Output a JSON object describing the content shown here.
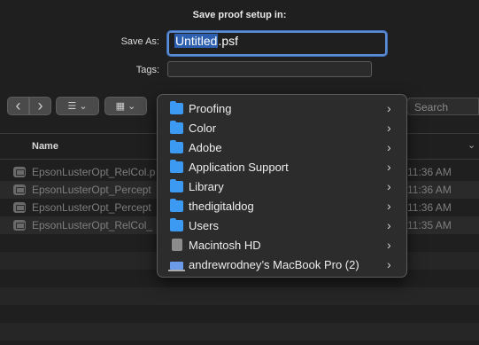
{
  "dialog": {
    "title": "Save proof setup in:",
    "save_as_label": "Save As:",
    "filename_selected": "Untitled",
    "filename_ext": ".psf",
    "tags_label": "Tags:"
  },
  "toolbar": {
    "back": "‹",
    "forward": "›",
    "list_view": "☰ ⌄",
    "grid_view": "▦ ⌄",
    "search_placeholder": "Search"
  },
  "columns": {
    "name": "Name",
    "sort_indicator": "⌄"
  },
  "files": [
    {
      "name": "EpsonLusterOpt_RelCol.p",
      "time": "11:36 AM"
    },
    {
      "name": "EpsonLusterOpt_Percept",
      "time": "11:36 AM"
    },
    {
      "name": "EpsonLusterOpt_Percept",
      "time": "11:36 AM"
    },
    {
      "name": "EpsonLusterOpt_RelCol_",
      "time": "11:35 AM"
    }
  ],
  "location_menu": [
    {
      "label": "Proofing",
      "icon": "folder-icon"
    },
    {
      "label": "Color",
      "icon": "folder-icon"
    },
    {
      "label": "Adobe",
      "icon": "folder-icon"
    },
    {
      "label": "Application Support",
      "icon": "folder-icon"
    },
    {
      "label": "Library",
      "icon": "folder-icon"
    },
    {
      "label": "thedigitaldog",
      "icon": "home-folder-icon"
    },
    {
      "label": "Users",
      "icon": "folder-icon"
    },
    {
      "label": "Macintosh HD",
      "icon": "hard-drive-icon"
    },
    {
      "label": "andrewrodney’s MacBook Pro (2)",
      "icon": "laptop-icon"
    }
  ],
  "chevron": "›"
}
